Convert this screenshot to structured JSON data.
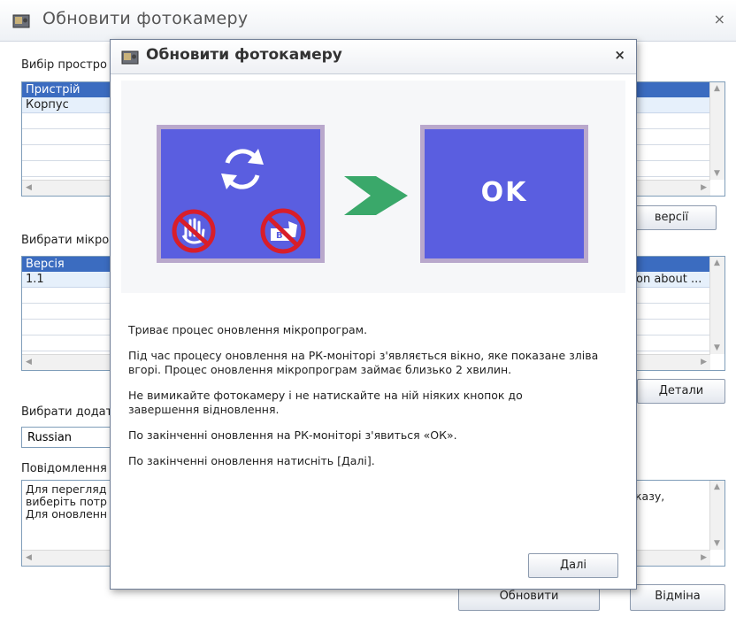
{
  "background_window": {
    "title": "Обновити фотокамеру",
    "close_label": "×",
    "section1_label": "Вибір простро",
    "list1": {
      "header": "Пристрій",
      "selected": "Корпус"
    },
    "versions_button": "версії",
    "section2_label": "Вибрати мікро",
    "list2": {
      "header": "Версія",
      "selected": "1.1",
      "right_text": "on about ..."
    },
    "details_button": "Детали",
    "section3_label": "Вибрати додат",
    "language_value": "Russian",
    "section4_label": "Повідомлення",
    "message_lines": [
      "Для перегляд",
      "виберіть потр",
      "Для оновленн"
    ],
    "message_right": "казу,",
    "update_button": "Обновити",
    "cancel_button": "Відміна"
  },
  "dialog": {
    "title": "Обновити фотокамеру",
    "close_label": "×",
    "ok_text": "OK",
    "paragraphs": [
      "Триває процес оновлення мікропрограм.",
      "Під час процесу оновлення на РК-моніторі з'являється вікно, яке показане зліва\nвгорі. Процес оновлення мікропрограм займає близько 2 хвилин.",
      "Не вимикайте фотокамеру і не натискайте на ній ніяких кнопок до\nзавершення відновлення.",
      "По закінченні оновлення на РК-моніторі з'явиться «ОК».",
      "По закінченні оновлення натисніть [Далі]."
    ],
    "next_button": "Далі"
  },
  "colors": {
    "panel_blue": "#5a5ee0",
    "arrow_green": "#3aa86a",
    "header_blue": "#3b6cc0"
  }
}
